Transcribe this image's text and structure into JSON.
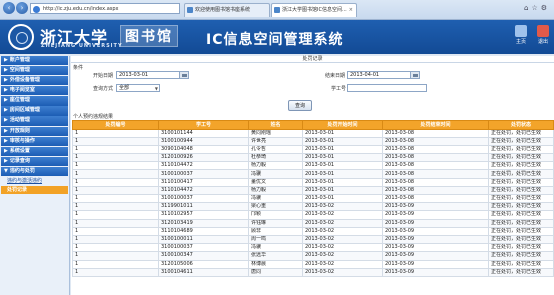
{
  "browser": {
    "address": "http://ic.zju.edu.cn/index.aspx",
    "tabs": [
      {
        "label": "欢迎使用图书馆书座系统",
        "active": false
      },
      {
        "label": "浙江大学图书馆IC信息空间...",
        "active": true
      }
    ]
  },
  "header": {
    "logo_cn": "浙江大学",
    "logo_en": "ZHEJIANG UNIVERSITY",
    "library": "图书馆",
    "system_title": "IC信息空间管理系统",
    "home_label": "主页",
    "exit_label": "退出",
    "colors": {
      "banner": "#1a56a4",
      "accent": "#f2a226"
    }
  },
  "sidebar": {
    "items": [
      {
        "label": "账户管理"
      },
      {
        "label": "空间管理"
      },
      {
        "label": "外借设备管理"
      },
      {
        "label": "电子阅览室"
      },
      {
        "label": "座位管理"
      },
      {
        "label": "房间区域管理"
      },
      {
        "label": "活动管理"
      },
      {
        "label": "开放规则"
      },
      {
        "label": "审核与操作"
      },
      {
        "label": "系统设置"
      },
      {
        "label": "记录查询"
      },
      {
        "label": "违约与处罚"
      }
    ],
    "sub_items": [
      {
        "label": "违约与激活违约",
        "active": false
      },
      {
        "label": "处罚记录",
        "active": true
      }
    ]
  },
  "main": {
    "page_title": "处罚记录",
    "condition_label": "条件",
    "start_date_label": "开始日期",
    "start_date": "2013-03-01",
    "end_date_label": "结束日期",
    "end_date": "2013-04-01",
    "mode_label": "查询方式",
    "mode_value": "全部",
    "student_id_label": "学工号",
    "student_id_value": "",
    "query_button": "查询",
    "section_label": "个人预约违规结果"
  },
  "table": {
    "headers": [
      "处罚编号",
      "学工号",
      "姓名",
      "处罚开始时间",
      "处罚结束时间",
      "处罚状态"
    ],
    "rows": [
      [
        "1",
        "3100101144",
        "黄同刚瑶",
        "2013-03-01",
        "2013-03-08",
        "正在处罚，处罚已生效"
      ],
      [
        "1",
        "3100100944",
        "许世亮",
        "2013-03-01",
        "2013-03-08",
        "正在处罚，处罚已生效"
      ],
      [
        "1",
        "3090104048",
        "孔令哲",
        "2013-03-01",
        "2013-03-08",
        "正在处罚，处罚已生效"
      ],
      [
        "1",
        "3120100926",
        "杜恭琦",
        "2013-03-01",
        "2013-03-08",
        "正在处罚，处罚已生效"
      ],
      [
        "1",
        "3110104472",
        "杨力毅",
        "2013-03-01",
        "2013-03-08",
        "正在处罚，处罚已生效"
      ],
      [
        "1",
        "3100100037",
        "冯骥",
        "2013-03-01",
        "2013-03-08",
        "正在处罚，处罚已生效"
      ],
      [
        "1",
        "3110100417",
        "董优文",
        "2013-03-01",
        "2013-03-08",
        "正在处罚，处罚已生效"
      ],
      [
        "1",
        "3110104472",
        "杨力毅",
        "2013-03-01",
        "2013-03-08",
        "正在处罚，处罚已生效"
      ],
      [
        "1",
        "3100100037",
        "冯骥",
        "2013-03-01",
        "2013-03-08",
        "正在处罚，处罚已生效"
      ],
      [
        "1",
        "3119901011",
        "梁心重",
        "2013-03-02",
        "2013-03-09",
        "正在处罚，处罚已生效"
      ],
      [
        "1",
        "3110102957",
        "邝颖",
        "2013-03-02",
        "2013-03-09",
        "正在处罚，处罚已生效"
      ],
      [
        "1",
        "3120103419",
        "许钰琳",
        "2013-03-02",
        "2013-03-09",
        "正在处罚，处罚已生效"
      ],
      [
        "1",
        "3110104689",
        "顾非",
        "2013-03-02",
        "2013-03-09",
        "正在处罚，处罚已生效"
      ],
      [
        "1",
        "3100100011",
        "周一鸣",
        "2013-03-02",
        "2013-03-09",
        "正在处罚，处罚已生效"
      ],
      [
        "1",
        "3100100037",
        "冯骥",
        "2013-03-02",
        "2013-03-09",
        "正在处罚，处罚已生效"
      ],
      [
        "1",
        "3100100347",
        "张远华",
        "2013-03-02",
        "2013-03-09",
        "正在处罚，处罚已生效"
      ],
      [
        "1",
        "3120105006",
        "林博晨",
        "2013-03-02",
        "2013-03-09",
        "正在处罚，处罚已生效"
      ],
      [
        "1",
        "3100104611",
        "唐同",
        "2013-03-02",
        "2013-03-09",
        "正在处罚，处罚已生效"
      ]
    ]
  }
}
